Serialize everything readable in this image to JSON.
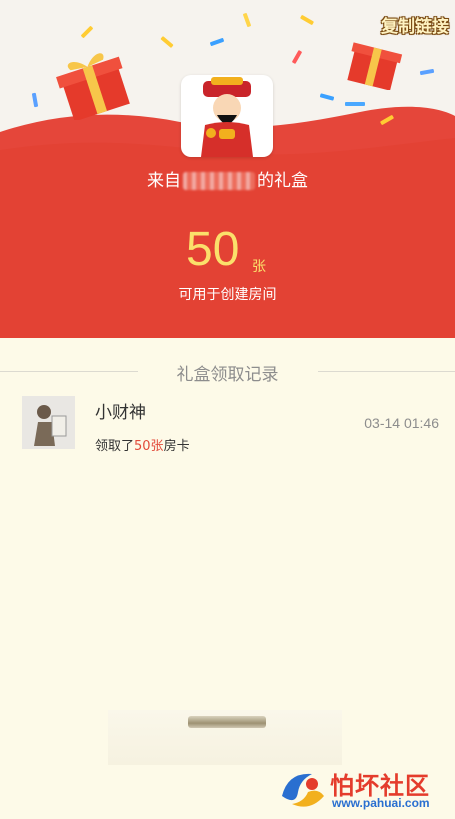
{
  "header": {
    "copy_link_label": "复制链接",
    "from_prefix": "来自",
    "from_suffix": "的礼盒",
    "amount": "50",
    "unit": "张",
    "usage_text": "可用于创建房间"
  },
  "records": {
    "title": "礼盒领取记录",
    "items": [
      {
        "name": "小财神",
        "desc_prefix": "领取了",
        "desc_amount": "50张",
        "desc_suffix": "房卡",
        "time": "03-14 01:46"
      }
    ]
  },
  "watermark": {
    "title": "怕坏社区",
    "url": "www.pahuai.com"
  },
  "colors": {
    "header_red": "#e5463a",
    "gold_text": "#fbe06b",
    "highlight_red": "#e24b3a",
    "page_bg": "#fdfae8"
  }
}
